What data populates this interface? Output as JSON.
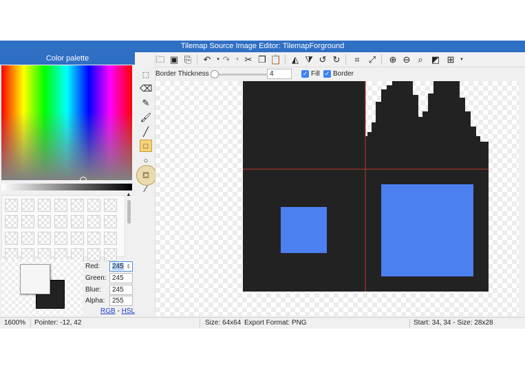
{
  "window": {
    "title": "Tilemap Source Image Editor: TilemapForground"
  },
  "palette": {
    "header": "Color palette",
    "red_label": "Red:",
    "red_value": "245",
    "green_label": "Green:",
    "green_value": "245",
    "blue_label": "Blue:",
    "blue_value": "245",
    "alpha_label": "Alpha:",
    "alpha_value": "255",
    "mode_rgb": "RGB",
    "mode_sep": "-",
    "mode_hsl": "HSL",
    "foreground_color": "#f5f5f5",
    "background_color": "#222222"
  },
  "toolbar": {
    "icons": [
      "new-file-icon",
      "open-folder-icon",
      "save-icon",
      "save-as-icon",
      "undo-icon",
      "redo-icon",
      "cut-icon",
      "copy-icon",
      "paste-icon",
      "flip-horizontal-icon",
      "flip-vertical-icon",
      "rotate-left-icon",
      "rotate-right-icon",
      "crop-icon",
      "resize-icon",
      "zoom-in-icon",
      "zoom-out-icon",
      "zoom-fit-icon",
      "invert-icon",
      "grid-icon"
    ]
  },
  "options": {
    "border_thickness_label": "Border Thickness",
    "border_thickness_value": "4",
    "fill_label": "Fill",
    "border_label": "Border",
    "fill_checked": true,
    "border_checked": true
  },
  "tools": [
    "select-icon",
    "eraser-icon",
    "pencil-icon",
    "brush-icon",
    "line-icon",
    "rectangle-icon",
    "ellipse-icon",
    "fill-bucket-icon",
    "eyedropper-icon"
  ],
  "active_tool": "rectangle-icon",
  "canvas": {
    "dark_color": "#222222",
    "blue_color": "#4a80f0",
    "guide_color": "#c0392b"
  },
  "status": {
    "zoom": "1600%",
    "pointer": "Pointer: -12, 42",
    "size": "Size: 64x64",
    "export": "Export Format: PNG",
    "selection": "Start: 34, 34 - Size: 28x28"
  }
}
